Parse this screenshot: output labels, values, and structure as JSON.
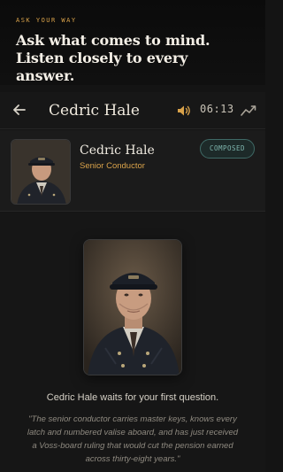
{
  "banner": {
    "eyebrow": "ASK YOUR WAY",
    "headline": "Ask what comes to mind. Listen closely to every answer."
  },
  "topbar": {
    "back_icon": "arrow-left-icon",
    "title": "Cedric Hale",
    "speaker_icon": "speaker-icon",
    "timer": "06:13",
    "trend_icon": "trend-icon"
  },
  "profile": {
    "name": "Cedric Hale",
    "role": "Senior Conductor",
    "badge": "COMPOSED"
  },
  "stage": {
    "waiting": "Cedric Hale waits for your first question.",
    "quote": "\"The senior conductor carries master keys, knows every latch and numbered valise aboard, and has just received a Voss-board ruling that would cut the pension earned across thirty-eight years.\""
  },
  "colors": {
    "accent": "#d9a24a",
    "badge": "#7fb6ae",
    "background": "#141414"
  }
}
